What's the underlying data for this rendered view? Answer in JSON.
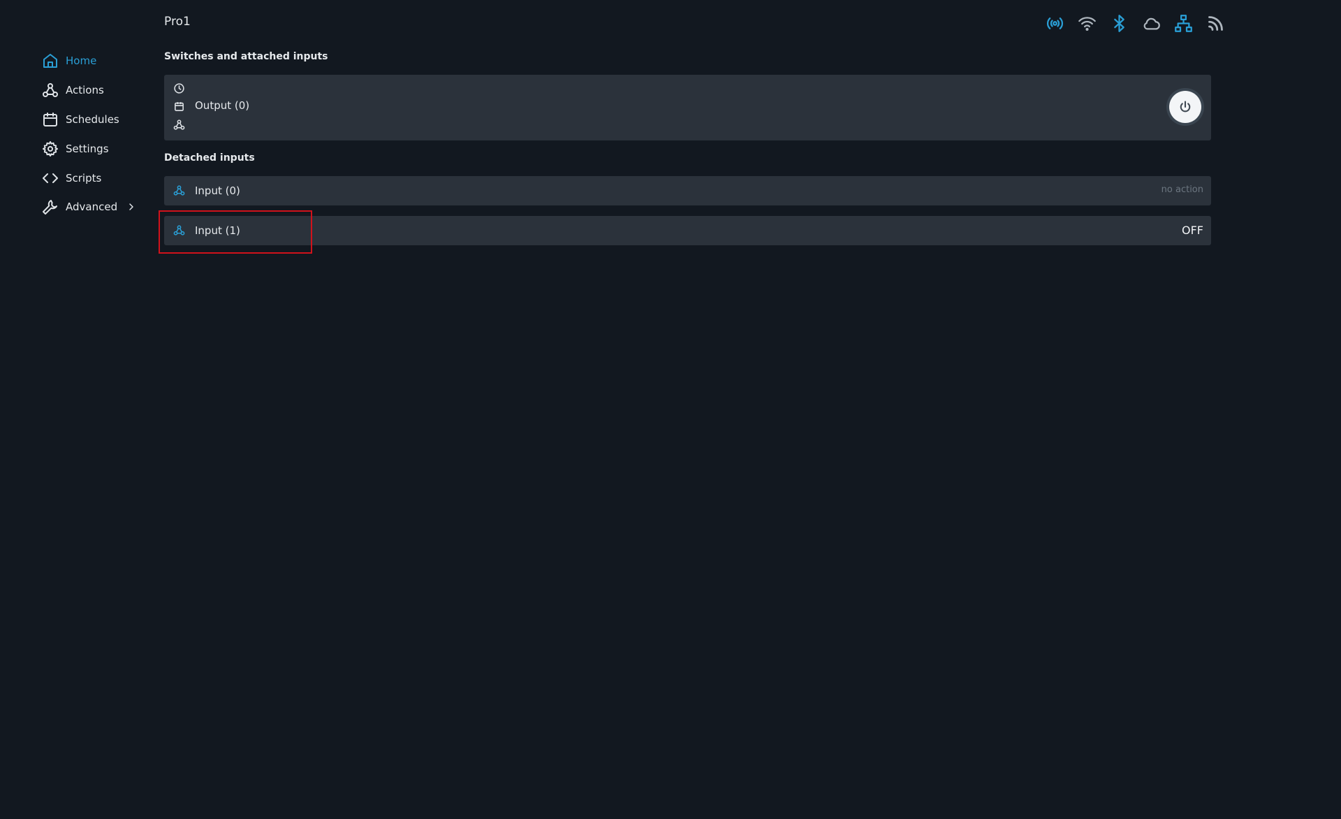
{
  "header": {
    "title": "Pro1",
    "status_icons": [
      "broadcast-icon",
      "wifi-icon",
      "bluetooth-icon",
      "cloud-icon",
      "network-icon",
      "rss-icon"
    ]
  },
  "sidebar": {
    "items": [
      {
        "label": "Home",
        "icon": "home-icon",
        "active": true
      },
      {
        "label": "Actions",
        "icon": "webhook-icon"
      },
      {
        "label": "Schedules",
        "icon": "calendar-icon"
      },
      {
        "label": "Settings",
        "icon": "gear-icon"
      },
      {
        "label": "Scripts",
        "icon": "code-icon"
      },
      {
        "label": "Advanced",
        "icon": "wrench-icon",
        "has_submenu": true
      }
    ]
  },
  "main": {
    "switches_heading": "Switches and attached inputs",
    "output": {
      "label": "Output (0)",
      "icons": [
        "clock-icon",
        "calendar-icon",
        "webhook-icon"
      ],
      "power_icon": "power-icon"
    },
    "detached_heading": "Detached inputs",
    "inputs": [
      {
        "label": "Input (0)",
        "state": "no action"
      },
      {
        "label": "Input (1)",
        "state": "OFF"
      }
    ]
  },
  "colors": {
    "background": "#121820",
    "card": "#2b323b",
    "accent": "#2a9fd6",
    "text": "#e6e9ec",
    "muted": "#6c7680",
    "highlight": "#d0121b"
  }
}
